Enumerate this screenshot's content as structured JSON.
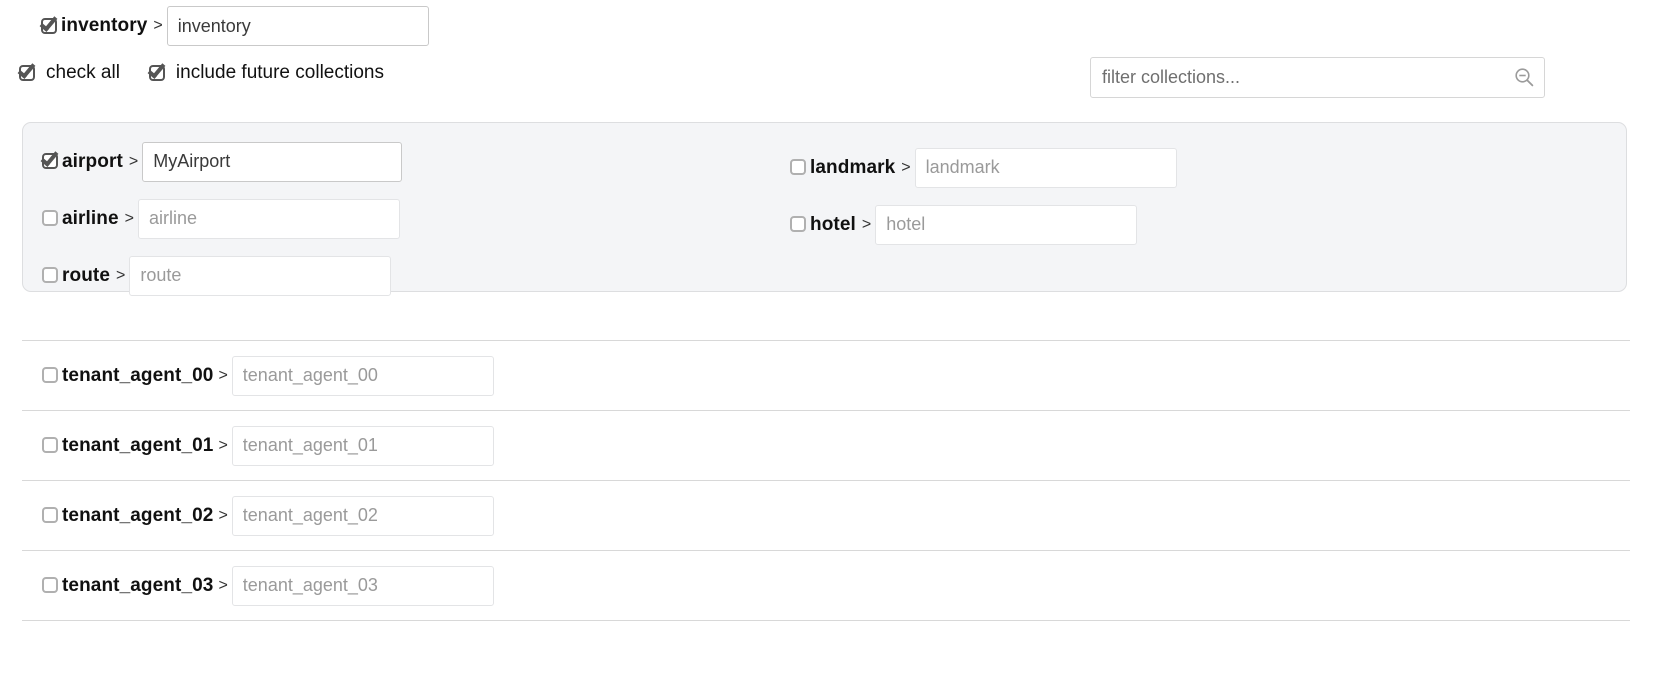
{
  "header": {
    "root": {
      "label": "inventory",
      "checked": true,
      "input_value": "inventory",
      "separator": ">"
    },
    "options": [
      {
        "label": "check all",
        "checked": true
      },
      {
        "label": "include future collections",
        "checked": true
      }
    ],
    "filter": {
      "placeholder": "filter collections...",
      "value": "",
      "icon": "search-zoom-out-icon"
    }
  },
  "collections_panel": {
    "left_column": [
      {
        "label": "airport",
        "separator": ">",
        "checked": true,
        "value": "MyAirport",
        "placeholder": "airport"
      },
      {
        "label": "airline",
        "separator": ">",
        "checked": false,
        "value": "",
        "placeholder": "airline"
      },
      {
        "label": "route",
        "separator": ">",
        "checked": false,
        "value": "",
        "placeholder": "route"
      }
    ],
    "right_column": [
      {
        "label": "landmark",
        "separator": ">",
        "checked": false,
        "value": "",
        "placeholder": "landmark"
      },
      {
        "label": "hotel",
        "separator": ">",
        "checked": false,
        "value": "",
        "placeholder": "hotel"
      }
    ]
  },
  "tenant_list": [
    {
      "label": "tenant_agent_00",
      "separator": ">",
      "checked": false,
      "value": "",
      "placeholder": "tenant_agent_00"
    },
    {
      "label": "tenant_agent_01",
      "separator": ">",
      "checked": false,
      "value": "",
      "placeholder": "tenant_agent_01"
    },
    {
      "label": "tenant_agent_02",
      "separator": ">",
      "checked": false,
      "value": "",
      "placeholder": "tenant_agent_02"
    },
    {
      "label": "tenant_agent_03",
      "separator": ">",
      "checked": false,
      "value": "",
      "placeholder": "tenant_agent_03"
    }
  ],
  "colors": {
    "panel_background": "#f4f5f7",
    "panel_border": "#dddee0",
    "divider": "#d8d8d8",
    "checkbox_checked": "#555555",
    "checkbox_unchecked": "#b0b0b0",
    "placeholder_text": "#9a9a9a",
    "label_text": "#111111"
  }
}
